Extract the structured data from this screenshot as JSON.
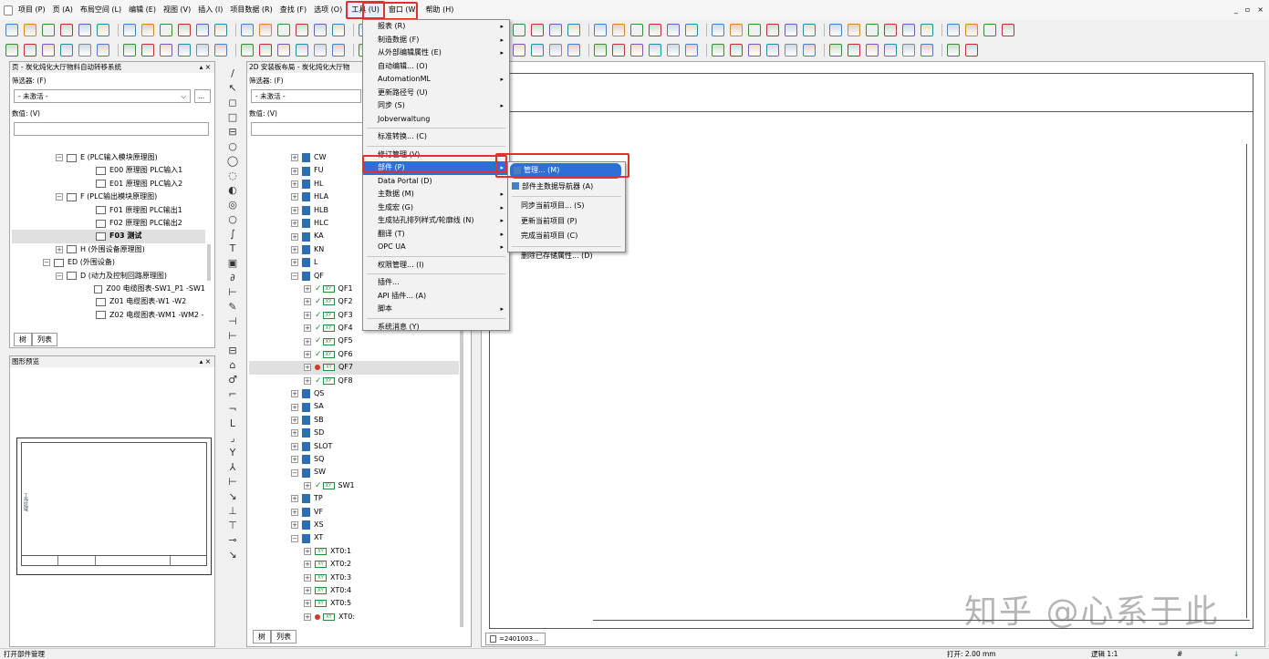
{
  "menubar": {
    "items": [
      "项目 (P)",
      "页 (A)",
      "布局空间 (L)",
      "编辑 (E)",
      "视图 (V)",
      "插入 (I)",
      "项目数据 (R)",
      "查找 (F)",
      "选项 (O)",
      "工具 (U)",
      "窗口 (W)",
      "帮助 (H)"
    ],
    "win_controls": [
      "_",
      "▫",
      "×"
    ]
  },
  "page_nav": {
    "title": "页 - 炭化炖化大厅物料自动转移系统",
    "filter_label": "筛选器: (F)",
    "filter_value": "- 未激活 -",
    "filter_btn": "...",
    "value_label": "数值: (V)",
    "tree": [
      {
        "exp": "−",
        "icon": "doc",
        "text": "E (PLC输入模块原理图)",
        "indent": 48
      },
      {
        "exp": "",
        "icon": "page",
        "text": "E00 原理图 PLC输入1",
        "indent": 80
      },
      {
        "exp": "",
        "icon": "page",
        "text": "E01 原理图 PLC输入2",
        "indent": 80
      },
      {
        "exp": "−",
        "icon": "doc",
        "text": "F (PLC输出模块原理图)",
        "indent": 48
      },
      {
        "exp": "",
        "icon": "page",
        "text": "F01 原理图 PLC输出1",
        "indent": 80
      },
      {
        "exp": "",
        "icon": "page",
        "text": "F02 原理图 PLC输出2",
        "indent": 80
      },
      {
        "exp": "",
        "icon": "page",
        "text": "F03 测试",
        "indent": 80,
        "selected": true
      },
      {
        "exp": "+",
        "icon": "doc",
        "text": "H (外围设备原理图)",
        "indent": 48
      },
      {
        "exp": "−",
        "icon": "doc",
        "text": "ED (外围设备)",
        "indent": 34
      },
      {
        "exp": "−",
        "icon": "doc",
        "text": "D (动力及控制回路原理图)",
        "indent": 48
      },
      {
        "exp": "",
        "icon": "page",
        "text": "Z00 电缆图表-SW1_P1 -SW1",
        "indent": 80
      },
      {
        "exp": "",
        "icon": "page",
        "text": "Z01 电缆图表-W1 -W2",
        "indent": 80
      },
      {
        "exp": "",
        "icon": "page",
        "text": "Z02 电缆图表-WM1 -WM2 -",
        "indent": 80
      }
    ],
    "tabs": [
      "树",
      "列表"
    ]
  },
  "preview": {
    "title": "图形预览",
    "side_label": "工作区域",
    "close": "▴ ×"
  },
  "device_nav": {
    "title": "2D 安装板布局 - 炭化炖化大厅物",
    "filter_label": "筛选器: (F)",
    "filter_value": "- 未激活 -",
    "value_label": "数值: (V)",
    "tree": [
      {
        "exp": "+",
        "icon": "folder",
        "text": "CW",
        "indent": 46
      },
      {
        "exp": "+",
        "icon": "folder",
        "text": "FU",
        "indent": 46
      },
      {
        "exp": "+",
        "icon": "folder",
        "text": "HL",
        "indent": 46
      },
      {
        "exp": "+",
        "icon": "folder",
        "text": "HLA",
        "indent": 46
      },
      {
        "exp": "+",
        "icon": "folder",
        "text": "HLB",
        "indent": 46
      },
      {
        "exp": "+",
        "icon": "folder",
        "text": "HLC",
        "indent": 46
      },
      {
        "exp": "+",
        "icon": "folder",
        "text": "KA",
        "indent": 46
      },
      {
        "exp": "+",
        "icon": "folder",
        "text": "KN",
        "indent": 46
      },
      {
        "exp": "+",
        "icon": "folder",
        "text": "L",
        "indent": 46
      },
      {
        "exp": "−",
        "icon": "folder",
        "text": "QF",
        "indent": 46
      },
      {
        "exp": "+",
        "icon": "dev",
        "check": true,
        "text": "QF1",
        "indent": 60
      },
      {
        "exp": "+",
        "icon": "dev",
        "check": true,
        "text": "QF2",
        "indent": 60
      },
      {
        "exp": "+",
        "icon": "dev",
        "check": true,
        "text": "QF3",
        "indent": 60
      },
      {
        "exp": "+",
        "icon": "dev",
        "check": true,
        "text": "QF4",
        "indent": 60
      },
      {
        "exp": "+",
        "icon": "dev",
        "check": true,
        "text": "QF5",
        "indent": 60
      },
      {
        "exp": "+",
        "icon": "dev",
        "check": true,
        "text": "QF6",
        "indent": 60
      },
      {
        "exp": "+",
        "icon": "dev",
        "dot": true,
        "text": "QF7",
        "indent": 60,
        "selected": true
      },
      {
        "exp": "+",
        "icon": "dev",
        "check": true,
        "text": "QF8",
        "indent": 60
      },
      {
        "exp": "+",
        "icon": "folder",
        "text": "QS",
        "indent": 46
      },
      {
        "exp": "+",
        "icon": "folder",
        "text": "SA",
        "indent": 46
      },
      {
        "exp": "+",
        "icon": "folder",
        "text": "SB",
        "indent": 46
      },
      {
        "exp": "+",
        "icon": "folder",
        "text": "SD",
        "indent": 46
      },
      {
        "exp": "+",
        "icon": "folder",
        "text": "SLOT",
        "indent": 46
      },
      {
        "exp": "+",
        "icon": "folder",
        "text": "SQ",
        "indent": 46
      },
      {
        "exp": "−",
        "icon": "folder",
        "text": "SW",
        "indent": 46
      },
      {
        "exp": "+",
        "icon": "dev",
        "check": true,
        "text": "SW1",
        "indent": 60
      },
      {
        "exp": "+",
        "icon": "folder",
        "text": "TP",
        "indent": 46
      },
      {
        "exp": "+",
        "icon": "folder",
        "text": "VF",
        "indent": 46
      },
      {
        "exp": "+",
        "icon": "folder",
        "text": "XS",
        "indent": 46
      },
      {
        "exp": "−",
        "icon": "folder",
        "text": "XT",
        "indent": 46
      },
      {
        "exp": "+",
        "icon": "dev",
        "text": "XT0:1",
        "indent": 60
      },
      {
        "exp": "+",
        "icon": "dev",
        "text": "XT0:2",
        "indent": 60
      },
      {
        "exp": "+",
        "icon": "dev",
        "text": "XT0:3",
        "indent": 60
      },
      {
        "exp": "+",
        "icon": "dev",
        "text": "XT0:4",
        "indent": 60
      },
      {
        "exp": "+",
        "icon": "dev",
        "text": "XT0:5",
        "indent": 60
      },
      {
        "exp": "+",
        "icon": "dev",
        "dot": true,
        "text": "XT0:",
        "indent": 60
      }
    ],
    "tabs": [
      "树",
      "列表"
    ]
  },
  "tools_menu": {
    "items": [
      {
        "label": "报表 (R)",
        "arrow": true
      },
      {
        "label": "制造数据 (F)",
        "arrow": true
      },
      {
        "label": "从外部编辑属性 (E)",
        "arrow": true
      },
      {
        "label": "自动编辑... (O)",
        "arrow": false
      },
      {
        "label": "AutomationML",
        "arrow": true
      },
      {
        "label": "更新路径号 (U)",
        "arrow": false
      },
      {
        "label": "同步 (S)",
        "arrow": true
      },
      {
        "label": "Jobverwaltung",
        "arrow": false
      },
      {
        "sep": true
      },
      {
        "label": "标准转换... (C)",
        "arrow": false
      },
      {
        "sep": true
      },
      {
        "label": "修订管理 (V)",
        "arrow": true
      },
      {
        "label": "部件 (P)",
        "arrow": true,
        "highlight": true
      },
      {
        "label": "Data Portal (D)",
        "arrow": false
      },
      {
        "label": "主数据 (M)",
        "arrow": true
      },
      {
        "label": "生成宏 (G)",
        "arrow": true
      },
      {
        "label": "生成钻孔排列样式/轮廓线 (N)",
        "arrow": true
      },
      {
        "label": "翻译 (T)",
        "arrow": true
      },
      {
        "label": "OPC UA",
        "arrow": true
      },
      {
        "sep": true
      },
      {
        "label": "权限管理... (I)",
        "arrow": false
      },
      {
        "sep": true
      },
      {
        "label": "插件...",
        "arrow": false
      },
      {
        "label": "API 插件... (A)",
        "arrow": false
      },
      {
        "label": "脚本",
        "arrow": true
      },
      {
        "sep": true
      },
      {
        "label": "系统消息 (Y)",
        "arrow": false
      }
    ]
  },
  "parts_submenu": {
    "items": [
      {
        "label": "管理... (M)",
        "highlight": true
      },
      {
        "label": "部件主数据导航器 (A)"
      },
      {
        "sep": true
      },
      {
        "label": "同步当前项目... (S)"
      },
      {
        "label": "更新当前项目 (P)"
      },
      {
        "label": "完成当前项目 (C)"
      },
      {
        "sep": true
      },
      {
        "label": "删除已存储属性... (D)"
      }
    ]
  },
  "graphic": {
    "tab_label": "=2401003..."
  },
  "status": {
    "left": "打开部件管理",
    "grid": "打开: 2.00 mm",
    "logic": "逻辑 1:1",
    "hash": "#"
  },
  "watermark": "知乎 @心系于此",
  "colors": {
    "highlight": "#2d6fd6",
    "red_box": "#e03030"
  }
}
